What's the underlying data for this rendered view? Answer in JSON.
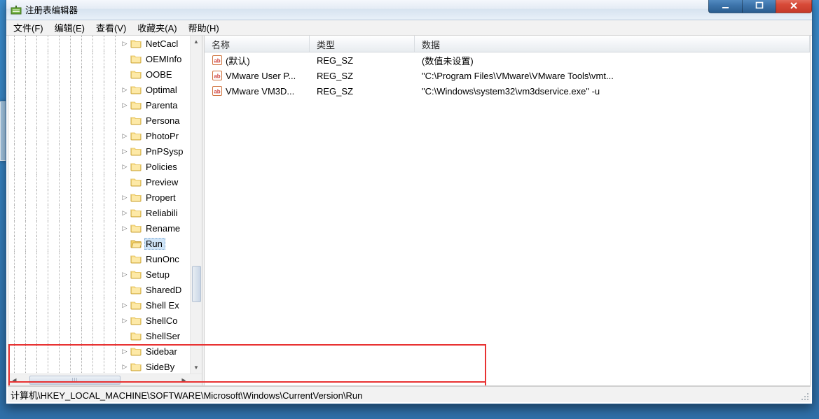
{
  "titlebar": {
    "title": "注册表编辑器"
  },
  "menubar": {
    "items": [
      {
        "label": "文件(F)"
      },
      {
        "label": "编辑(E)"
      },
      {
        "label": "查看(V)"
      },
      {
        "label": "收藏夹(A)"
      },
      {
        "label": "帮助(H)"
      }
    ]
  },
  "tree": {
    "items": [
      {
        "label": "NetCacl",
        "expandable": true
      },
      {
        "label": "OEMInfo",
        "expandable": false
      },
      {
        "label": "OOBE",
        "expandable": false
      },
      {
        "label": "Optimal",
        "expandable": true
      },
      {
        "label": "Parenta",
        "expandable": true
      },
      {
        "label": "Persona",
        "expandable": false
      },
      {
        "label": "PhotoPr",
        "expandable": true
      },
      {
        "label": "PnPSysp",
        "expandable": true
      },
      {
        "label": "Policies",
        "expandable": true
      },
      {
        "label": "Preview",
        "expandable": false
      },
      {
        "label": "Propert",
        "expandable": true
      },
      {
        "label": "Reliabili",
        "expandable": true
      },
      {
        "label": "Rename",
        "expandable": true
      },
      {
        "label": "Run",
        "expandable": false,
        "selected": true
      },
      {
        "label": "RunOnc",
        "expandable": false
      },
      {
        "label": "Setup",
        "expandable": true
      },
      {
        "label": "SharedD",
        "expandable": false
      },
      {
        "label": "Shell Ex",
        "expandable": true
      },
      {
        "label": "ShellCo",
        "expandable": true
      },
      {
        "label": "ShellSer",
        "expandable": false
      },
      {
        "label": "Sidebar",
        "expandable": true
      },
      {
        "label": "SideBy",
        "expandable": true
      }
    ]
  },
  "list": {
    "columns": {
      "name": "名称",
      "type": "类型",
      "data_": "数据"
    },
    "rows": [
      {
        "name": "(默认)",
        "type_": "REG_SZ",
        "data_": "(数值未设置)"
      },
      {
        "name": "VMware User P...",
        "type_": "REG_SZ",
        "data_": "\"C:\\Program Files\\VMware\\VMware Tools\\vmt..."
      },
      {
        "name": "VMware VM3D...",
        "type_": "REG_SZ",
        "data_": "\"C:\\Windows\\system32\\vm3dservice.exe\" -u"
      }
    ]
  },
  "statusbar": {
    "path": "计算机\\HKEY_LOCAL_MACHINE\\SOFTWARE\\Microsoft\\Windows\\CurrentVersion\\Run"
  }
}
